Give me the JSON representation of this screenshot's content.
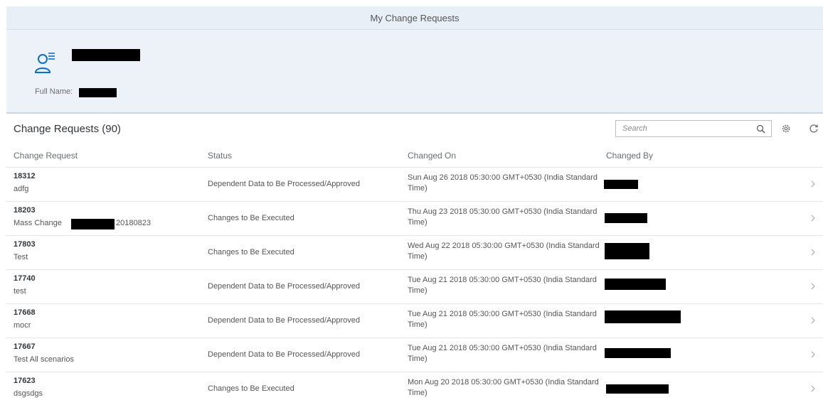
{
  "window": {
    "title": "My Change Requests"
  },
  "header": {
    "full_name_label": "Full Name:"
  },
  "toolbar": {
    "title": "Change Requests (90)",
    "search_placeholder": "Search"
  },
  "table": {
    "columns": [
      "Change Request",
      "Status",
      "Changed On",
      "Changed By"
    ],
    "rows": [
      {
        "id": "18312",
        "desc": "adfg",
        "status": "Dependent Data to Be Processed/Approved",
        "changed_on": "Sun Aug 26 2018 05:30:00 GMT+0530 (India Standard Time)"
      },
      {
        "id": "18203",
        "desc": "Mass Change",
        "desc_suffix": "20180823",
        "status": "Changes to Be Executed",
        "changed_on": "Thu Aug 23 2018 05:30:00 GMT+0530 (India Standard Time)"
      },
      {
        "id": "17803",
        "desc": "Test",
        "status": "Changes to Be Executed",
        "changed_on": "Wed Aug 22 2018 05:30:00 GMT+0530 (India Standard Time)"
      },
      {
        "id": "17740",
        "desc": "test",
        "status": "Dependent Data to Be Processed/Approved",
        "changed_on": "Tue Aug 21 2018 05:30:00 GMT+0530 (India Standard Time)"
      },
      {
        "id": "17668",
        "desc": "mocr",
        "status": "Dependent Data to Be Processed/Approved",
        "changed_on": "Tue Aug 21 2018 05:30:00 GMT+0530 (India Standard Time)"
      },
      {
        "id": "17667",
        "desc": "Test All scenarios",
        "status": "Dependent Data to Be Processed/Approved",
        "changed_on": "Tue Aug 21 2018 05:30:00 GMT+0530 (India Standard Time)"
      },
      {
        "id": "17623",
        "desc": "dsgsdgs",
        "status": "Changes to Be Executed",
        "changed_on": "Mon Aug 20 2018 05:30:00 GMT+0530 (India Standard Time)"
      }
    ]
  },
  "icons": {
    "user": "user-list-icon",
    "search": "search-icon",
    "settings": "gear-icon",
    "refresh": "refresh-icon",
    "row_nav": "chevron-right-icon"
  },
  "colors": {
    "accent": "#0a6ed1",
    "header_bg": "#edf2f8"
  }
}
